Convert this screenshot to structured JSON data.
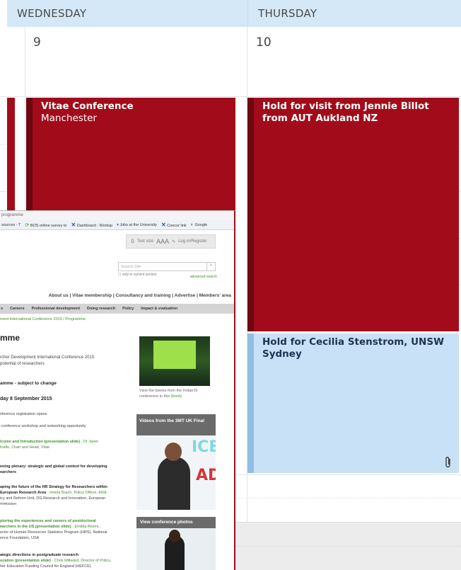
{
  "calendar": {
    "days": [
      {
        "name": "WEDNESDAY",
        "date": "9"
      },
      {
        "name": "THURSDAY",
        "date": "10"
      }
    ],
    "events": [
      {
        "title": "Vitae Conference",
        "subtitle": "Manchester",
        "color": "#a20c1a"
      },
      {
        "title": "Hold for visit from Jennie Billot from AUT Aukland NZ",
        "color": "#a20c1a"
      },
      {
        "title": "Hold for Cecilia Stenstrom, UNSW Sydney",
        "color": "#c9e1f6",
        "attachment_icon": "paperclip-icon"
      }
    ]
  },
  "screenshot": {
    "titlebar": "programme",
    "bookmarks": [
      "sources - T",
      "BOS online survey to",
      "Dashboard - Worksp",
      "Jobs at the University",
      "Concur link",
      "Google"
    ],
    "tools": {
      "text_size": "Text size",
      "text_size_glyphs": "AAA",
      "login": "Log in/Register"
    },
    "search": {
      "placeholder": "Search Site",
      "only_current": "only in current section",
      "advanced": "advanced search"
    },
    "top_links": "About us  |  Vitae membership  |  Consultancy and training  |  Advertise  |  Members' area",
    "nav": [
      "s",
      "Careers",
      "Professional development",
      "Doing research",
      "Policy",
      "Impact & evaluation"
    ],
    "breadcrumb": "ment International Conference 2015 / Programme",
    "heading": "mme",
    "intro_line1": "rcher Development International Conference 2015:",
    "intro_line2": "potential of researchers",
    "programme_heading": "amme - subject to change",
    "date_heading": "day 8 September 2015",
    "items": [
      {
        "text": "nference registration opens"
      },
      {
        "text": "-conference workshop and networking opportunity"
      },
      {
        "title": "lcome and Introduction (presentation slide)",
        "rest": " - Dr Janet",
        "line2": "tcalfe, Chair and Head, Vitae"
      },
      {
        "title": "ening plenary: strategic and global context for developing",
        "line2": "earchers"
      },
      {
        "title": "aping the future of the HR Strategy for Researchers within",
        "line2": "European Research Area",
        "rest2": " - Irmela Brach, Policy Officer, ERA",
        "line3": "icy and Reform Unit, DG Research and Innovation, European",
        "line4": "mmission"
      },
      {
        "title": "ploring the experiences and careers of postdoctoral",
        "line2": "earchers in the US (presentation slide)",
        "rest2": " - Emilda Rivers,",
        "line3": "ector of Human Resources Statistics Program (HRS), National",
        "line4": "ence Foundation, USA"
      },
      {
        "title": "ategic directions in postgraduate research",
        "line2": "ucation (presentation slide)",
        "rest2": " - Chris Millward, Director of Policy,",
        "line3": "her Education Funding Council for England (HEFCE)"
      }
    ],
    "sidebar": {
      "tweets_caption": "View the tweets from the #vitae15 conference in this",
      "tweets_link": "Storify",
      "videos_heading": "Videos from the 3MT UK Final",
      "video_text_1": "ICE",
      "video_text_2": "AD",
      "photos_heading": "View conference photos"
    }
  }
}
